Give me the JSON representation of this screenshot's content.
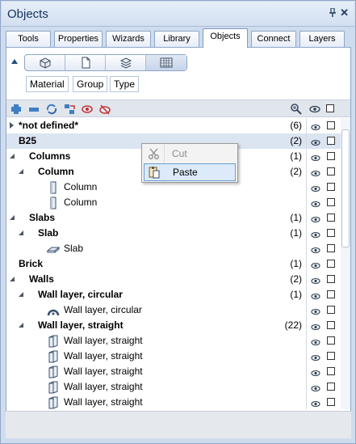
{
  "window": {
    "title": "Objects",
    "pin_glyph": "⬇",
    "close_glyph": "✕"
  },
  "tabs": [
    {
      "label": "Tools",
      "active": false
    },
    {
      "label": "Properties",
      "active": false
    },
    {
      "label": "Wizards",
      "active": false
    },
    {
      "label": "Library",
      "active": false
    },
    {
      "label": "Objects",
      "active": true
    },
    {
      "label": "Connect",
      "active": false
    },
    {
      "label": "Layers",
      "active": false
    }
  ],
  "filter": {
    "view_buttons": [
      "structure-icon",
      "document-icon",
      "layers-icon",
      "grid-icon"
    ],
    "criteria": [
      "Material",
      "Group",
      "Type"
    ]
  },
  "toolbar": {
    "icons": [
      "expand-all-icon",
      "collapse-all-icon",
      "update-icon",
      "transfer-icon",
      "hide-icon",
      "show-icon"
    ],
    "right_icons": [
      "zoom-icon",
      "eye-icon",
      "checkbox-icon"
    ]
  },
  "tree": {
    "rows": [
      {
        "label": "*not defined*",
        "count": "(6)",
        "bold": true
      },
      {
        "label": "B25",
        "count": "(2)",
        "bold": true
      },
      {
        "label": "Columns",
        "count": "(1)",
        "bold": true
      },
      {
        "label": "Column",
        "count": "(2)",
        "bold": true
      },
      {
        "label": "Column",
        "count": "",
        "bold": false
      },
      {
        "label": "Column",
        "count": "",
        "bold": false
      },
      {
        "label": "Slabs",
        "count": "(1)",
        "bold": true
      },
      {
        "label": "Slab",
        "count": "(1)",
        "bold": true
      },
      {
        "label": "Slab",
        "count": "",
        "bold": false
      },
      {
        "label": "Brick",
        "count": "(1)",
        "bold": true
      },
      {
        "label": "Walls",
        "count": "(2)",
        "bold": true
      },
      {
        "label": "Wall layer, circular",
        "count": "(1)",
        "bold": true
      },
      {
        "label": "Wall layer, circular",
        "count": "",
        "bold": false
      },
      {
        "label": "Wall layer, straight",
        "count": "(22)",
        "bold": true
      },
      {
        "label": "Wall layer, straight",
        "count": "",
        "bold": false
      },
      {
        "label": "Wall layer, straight",
        "count": "",
        "bold": false
      },
      {
        "label": "Wall layer, straight",
        "count": "",
        "bold": false
      },
      {
        "label": "Wall layer, straight",
        "count": "",
        "bold": false
      },
      {
        "label": "Wall layer, straight",
        "count": "",
        "bold": false
      }
    ]
  },
  "context_menu": {
    "items": [
      {
        "label": "Cut",
        "icon": "scissors-icon",
        "enabled": false
      },
      {
        "label": "Paste",
        "icon": "paste-icon",
        "enabled": true
      }
    ]
  },
  "colors": {
    "accent": "#1f4d80",
    "selection": "#dbe4f1",
    "panel": "#cfdcee"
  }
}
